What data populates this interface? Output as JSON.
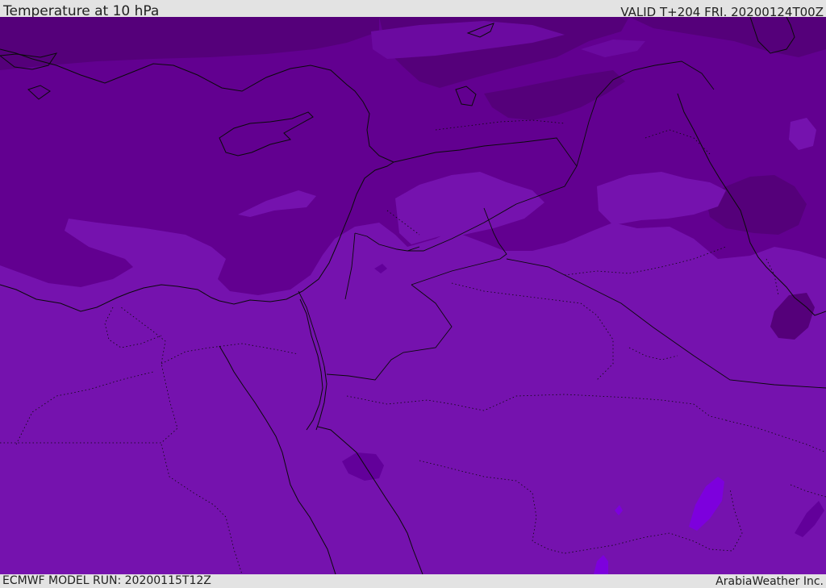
{
  "header": {
    "title": "Temperature at 10 hPa",
    "valid_text": "VALID T+204 FRI. 20200124T00Z"
  },
  "footer": {
    "model_run": "ECMWF MODEL RUN: 20200115T12Z",
    "credit": "ArabiaWeather Inc."
  },
  "map": {
    "field": "temperature",
    "pressure_level": "10 hPa",
    "colors": {
      "darkest_purple": "#55007a",
      "dark_purple": "#620090",
      "mid_purple": "#7512ae",
      "blue_violet": "#7d00dd",
      "coastline": "#0a0a0a"
    }
  }
}
